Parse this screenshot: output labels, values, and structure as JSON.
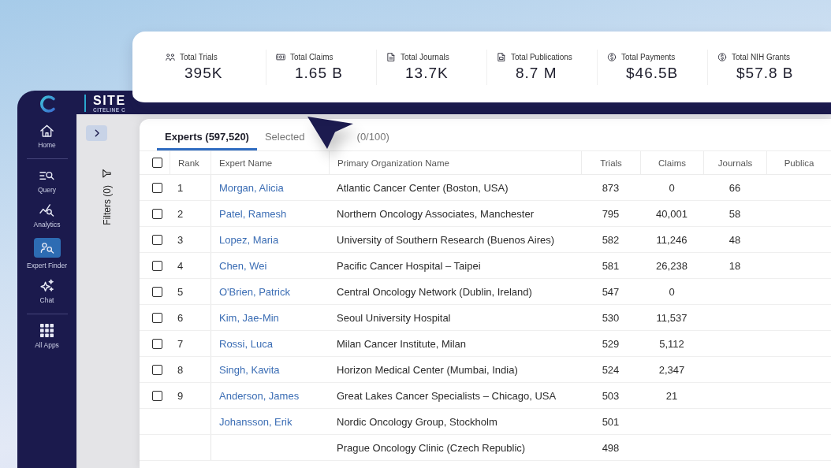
{
  "header": {
    "brand": "SITE",
    "subtitle": "CITELINE C"
  },
  "stats": [
    {
      "label": "Total Trials",
      "value": "395K"
    },
    {
      "label": "Total Claims",
      "value": "1.65 B"
    },
    {
      "label": "Total Journals",
      "value": "13.7K"
    },
    {
      "label": "Total Publications",
      "value": "8.7 M"
    },
    {
      "label": "Total Payments",
      "value": "$46.5B"
    },
    {
      "label": "Total NIH Grants",
      "value": "$57.8 B"
    }
  ],
  "sidebar": {
    "groups": [
      {
        "items": [
          {
            "label": "Home",
            "selected": false
          }
        ]
      },
      {
        "items": [
          {
            "label": "Query",
            "selected": false
          },
          {
            "label": "Analytics",
            "selected": false
          },
          {
            "label": "Expert Finder",
            "selected": true
          },
          {
            "label": "Chat",
            "selected": false
          }
        ]
      },
      {
        "items": [
          {
            "label": "All Apps",
            "selected": false
          }
        ]
      }
    ]
  },
  "filters": {
    "label": "Filters (0)"
  },
  "tabs": [
    {
      "label": "Experts (597,520)",
      "selected": true
    },
    {
      "label": "Selected",
      "suffix": "(0/100)",
      "selected": false
    }
  ],
  "table": {
    "select_all": {
      "checked": false
    },
    "columns": [
      "Rank",
      "Expert Name",
      "Primary Organization Name",
      "Trials",
      "Claims",
      "Journals",
      "Publica"
    ],
    "rows": [
      {
        "checked": false,
        "rank": "1",
        "name": "Morgan, Alicia",
        "organization": "Atlantic Cancer Center (Boston, USA)",
        "trials": "873",
        "claims": "0",
        "journals": "66"
      },
      {
        "checked": false,
        "rank": "2",
        "name": "Patel, Ramesh",
        "organization": "Northern Oncology Associates, Manchester",
        "trials": "795",
        "claims": "40,001",
        "journals": "58"
      },
      {
        "checked": false,
        "rank": "3",
        "name": "Lopez, Maria",
        "organization": "University of Southern Research (Buenos Aires)",
        "trials": "582",
        "claims": "11,246",
        "journals": "48"
      },
      {
        "checked": false,
        "rank": "4",
        "name": "Chen, Wei",
        "organization": "Pacific Cancer Hospital – Taipei",
        "trials": "581",
        "claims": "26,238",
        "journals": "18"
      },
      {
        "checked": false,
        "rank": "5",
        "name": "O'Brien, Patrick",
        "organization": "Central Oncology Network (Dublin, Ireland)",
        "trials": "547",
        "claims": "0"
      },
      {
        "checked": false,
        "rank": "6",
        "name": "Kim, Jae-Min",
        "organization": "Seoul University Hospital",
        "trials": "530",
        "claims": "11,537"
      },
      {
        "checked": false,
        "rank": "7",
        "name": "Rossi, Luca",
        "organization": "Milan Cancer Institute, Milan",
        "trials": "529",
        "claims": "5,112"
      },
      {
        "checked": false,
        "rank": "8",
        "name": "Singh, Kavita",
        "organization": "Horizon Medical Center (Mumbai, India)",
        "trials": "524",
        "claims": "2,347"
      },
      {
        "checked": false,
        "rank": "9",
        "name": "Anderson, James",
        "organization": "Great Lakes Cancer Specialists – Chicago, USA",
        "trials": "503",
        "claims": "21"
      },
      {
        "name": "Johansson, Erik",
        "organization": "Nordic Oncology Group, Stockholm",
        "trials": "501"
      },
      {
        "organization": "Prague Oncology Clinic (Czech Republic)",
        "trials": "498"
      }
    ]
  }
}
